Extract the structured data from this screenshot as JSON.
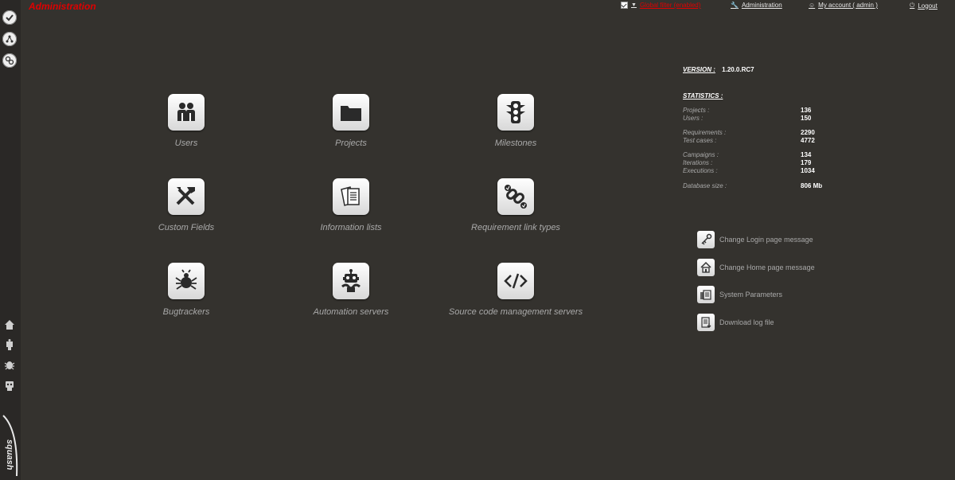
{
  "header": {
    "title": "Administration",
    "filter_label": "Global filter (enabled)",
    "admin_link": "Administration",
    "account_link": "My account ( admin )",
    "logout_link": "Logout"
  },
  "tiles": [
    {
      "label": "Users",
      "icon": "users-icon"
    },
    {
      "label": "Projects",
      "icon": "folder-icon"
    },
    {
      "label": "Milestones",
      "icon": "traffic-light-icon"
    },
    {
      "label": "Custom Fields",
      "icon": "tools-icon"
    },
    {
      "label": "Information lists",
      "icon": "documents-icon"
    },
    {
      "label": "Requirement link types",
      "icon": "chain-link-icon"
    },
    {
      "label": "Bugtrackers",
      "icon": "bug-icon"
    },
    {
      "label": "Automation servers",
      "icon": "robot-icon"
    },
    {
      "label": "Source code management servers",
      "icon": "code-icon"
    }
  ],
  "version": {
    "label": "VERSION :",
    "value": "1.20.0.RC7"
  },
  "statistics": {
    "title": "STATISTICS :",
    "rows": [
      {
        "key": "Projects :",
        "value": "136"
      },
      {
        "key": "Users :",
        "value": "150"
      },
      {
        "key": "Requirements :",
        "value": "2290"
      },
      {
        "key": "Test cases :",
        "value": "4772"
      },
      {
        "key": "Campaigns :",
        "value": "134"
      },
      {
        "key": "Iterations :",
        "value": "179"
      },
      {
        "key": "Executions :",
        "value": "1034"
      },
      {
        "key": "Database size :",
        "value": "806 Mb"
      }
    ]
  },
  "actions": [
    {
      "label": "Change Login page message",
      "icon": "key-icon"
    },
    {
      "label": "Change Home page message",
      "icon": "house-icon"
    },
    {
      "label": "System Parameters",
      "icon": "settings-icon"
    },
    {
      "label": "Download log file",
      "icon": "download-icon"
    }
  ],
  "rail": {
    "top_icons": [
      "check-circle-icon",
      "requirements-icon",
      "link-icon"
    ],
    "bottom_icons": [
      "home-icon",
      "automation-icon",
      "bug-icon",
      "robot-icon"
    ],
    "logo": "squash-logo"
  },
  "colors": {
    "background": "#34322e",
    "accent_red": "#e00000"
  }
}
